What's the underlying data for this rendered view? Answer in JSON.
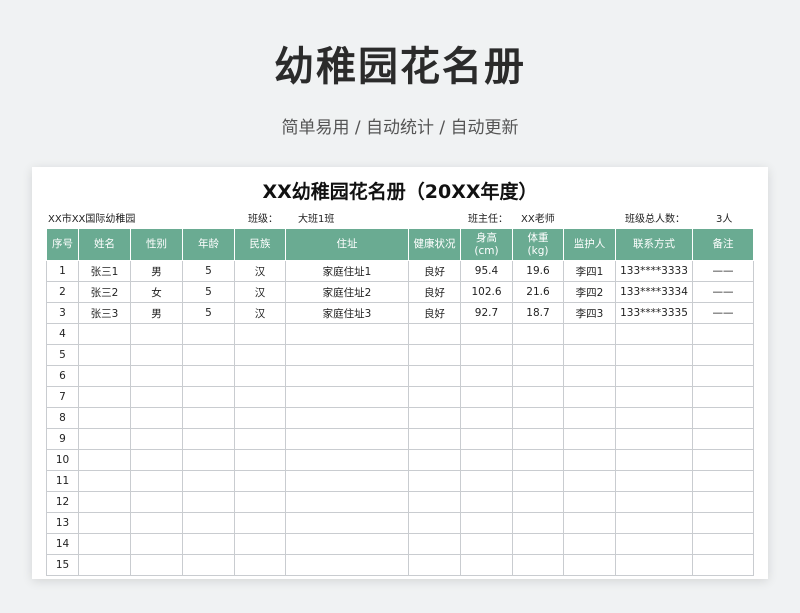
{
  "page": {
    "title": "幼稚园花名册",
    "subtitle": "简单易用 / 自动统计 / 自动更新"
  },
  "sheet": {
    "title": "XX幼稚园花名册（20XX年度）",
    "school": "XX市XX国际幼稚园",
    "class_label": "班级：",
    "class_value": "大班1班",
    "teacher_label": "班主任：",
    "teacher_value": "XX老师",
    "count_label": "班级总人数：",
    "count_value": "3人"
  },
  "table": {
    "headers": [
      "序号",
      "姓名",
      "性别",
      "年龄",
      "民族",
      "住址",
      "健康状况",
      "身高\n(cm)",
      "体重\n(kg)",
      "监护人",
      "联系方式",
      "备注"
    ],
    "rows": [
      [
        "1",
        "张三1",
        "男",
        "5",
        "汉",
        "家庭住址1",
        "良好",
        "95.4",
        "19.6",
        "李四1",
        "133****3333",
        "——"
      ],
      [
        "2",
        "张三2",
        "女",
        "5",
        "汉",
        "家庭住址2",
        "良好",
        "102.6",
        "21.6",
        "李四2",
        "133****3334",
        "——"
      ],
      [
        "3",
        "张三3",
        "男",
        "5",
        "汉",
        "家庭住址3",
        "良好",
        "92.7",
        "18.7",
        "李四3",
        "133****3335",
        "——"
      ],
      [
        "4",
        "",
        "",
        "",
        "",
        "",
        "",
        "",
        "",
        "",
        "",
        ""
      ],
      [
        "5",
        "",
        "",
        "",
        "",
        "",
        "",
        "",
        "",
        "",
        "",
        ""
      ],
      [
        "6",
        "",
        "",
        "",
        "",
        "",
        "",
        "",
        "",
        "",
        "",
        ""
      ],
      [
        "7",
        "",
        "",
        "",
        "",
        "",
        "",
        "",
        "",
        "",
        "",
        ""
      ],
      [
        "8",
        "",
        "",
        "",
        "",
        "",
        "",
        "",
        "",
        "",
        "",
        ""
      ],
      [
        "9",
        "",
        "",
        "",
        "",
        "",
        "",
        "",
        "",
        "",
        "",
        ""
      ],
      [
        "10",
        "",
        "",
        "",
        "",
        "",
        "",
        "",
        "",
        "",
        "",
        ""
      ],
      [
        "11",
        "",
        "",
        "",
        "",
        "",
        "",
        "",
        "",
        "",
        "",
        ""
      ],
      [
        "12",
        "",
        "",
        "",
        "",
        "",
        "",
        "",
        "",
        "",
        "",
        ""
      ],
      [
        "13",
        "",
        "",
        "",
        "",
        "",
        "",
        "",
        "",
        "",
        "",
        ""
      ],
      [
        "14",
        "",
        "",
        "",
        "",
        "",
        "",
        "",
        "",
        "",
        "",
        ""
      ],
      [
        "15",
        "",
        "",
        "",
        "",
        "",
        "",
        "",
        "",
        "",
        "",
        ""
      ]
    ]
  },
  "colors": {
    "header_bg": "#6aab92",
    "page_bg": "#f0f2f3"
  }
}
